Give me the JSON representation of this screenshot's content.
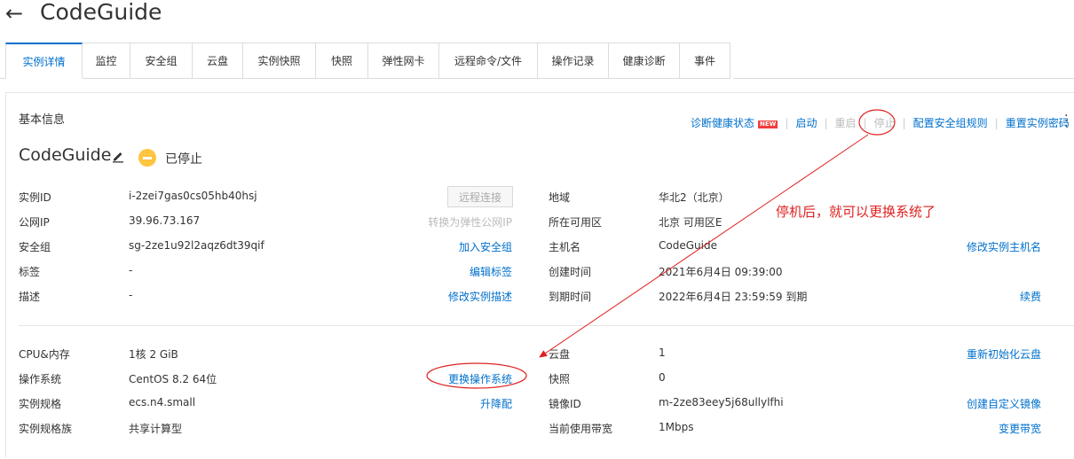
{
  "header": {
    "title": "CodeGuide"
  },
  "tabs": [
    {
      "label": "实例详情",
      "active": true
    },
    {
      "label": "监控"
    },
    {
      "label": "安全组"
    },
    {
      "label": "云盘"
    },
    {
      "label": "实例快照"
    },
    {
      "label": "快照"
    },
    {
      "label": "弹性网卡"
    },
    {
      "label": "远程命令/文件"
    },
    {
      "label": "操作记录"
    },
    {
      "label": "健康诊断"
    },
    {
      "label": "事件"
    }
  ],
  "section": {
    "title": "基本信息"
  },
  "actions": {
    "diagnose": "诊断健康状态",
    "new_badge": "NEW",
    "start": "启动",
    "restart": "重启",
    "stop": "停止",
    "config_sg": "配置安全组规则",
    "reset_password": "重置实例密码"
  },
  "instance": {
    "name": "CodeGuide",
    "status": "已停止",
    "status_color": "#ffc440"
  },
  "left_info": [
    {
      "label": "实例ID",
      "value": "i-2zei7gas0cs05hb40hsj"
    },
    {
      "label": "公网IP",
      "value": "39.96.73.167"
    },
    {
      "label": "安全组",
      "value": "sg-2ze1u92l2aqz6dt39qif"
    },
    {
      "label": "标签",
      "value": "-"
    },
    {
      "label": "描述",
      "value": "-"
    }
  ],
  "left_links": {
    "remote_connect": "远程连接",
    "convert_eip": "转换为弹性公网IP",
    "join_sg": "加入安全组",
    "edit_tags": "编辑标签",
    "edit_desc": "修改实例描述"
  },
  "right_info": [
    {
      "label": "地域",
      "value": "华北2（北京）"
    },
    {
      "label": "所在可用区",
      "value": "北京 可用区E"
    },
    {
      "label": "主机名",
      "value": "CodeGuide"
    },
    {
      "label": "创建时间",
      "value": "2021年6月4日 09:39:00"
    },
    {
      "label": "到期时间",
      "value": "2022年6月4日 23:59:59 到期"
    }
  ],
  "right_links": {
    "modify_hostname": "修改实例主机名",
    "renew": "续费"
  },
  "annotation": {
    "text": "停机后，就可以更换系统了",
    "color": "#e02020"
  },
  "left_info2": [
    {
      "label": "CPU&内存",
      "value": "1核 2 GiB"
    },
    {
      "label": "操作系统",
      "value": "CentOS 8.2 64位"
    },
    {
      "label": "实例规格",
      "value": "ecs.n4.small"
    },
    {
      "label": "实例规格族",
      "value": "共享计算型"
    }
  ],
  "left_links2": {
    "change_os": "更换操作系统",
    "upgrade": "升降配"
  },
  "right_info2": [
    {
      "label": "云盘",
      "value": "1"
    },
    {
      "label": "快照",
      "value": "0"
    },
    {
      "label": "镜像ID",
      "value": "m-2ze83eey5j68ullylfhi"
    },
    {
      "label": "当前使用带宽",
      "value": "1Mbps"
    }
  ],
  "right_links2": {
    "reinit_disk": "重新初始化云盘",
    "create_image": "创建自定义镜像",
    "change_bandwidth": "变更带宽"
  },
  "colors": {
    "link": "#0070cc",
    "accent": "#0070cc",
    "annotation": "#e02020"
  }
}
